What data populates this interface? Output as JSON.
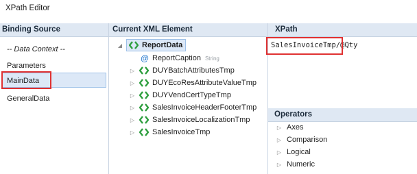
{
  "window": {
    "title": "XPath Editor"
  },
  "binding_source": {
    "header": "Binding Source",
    "items": [
      {
        "label": "-- Data Context --",
        "italic": true
      },
      {
        "label": "Parameters"
      },
      {
        "label": "MainData",
        "selected": true
      },
      {
        "label": "GeneralData"
      }
    ]
  },
  "xml_element": {
    "header": "Current XML Element",
    "root": {
      "label": "ReportData",
      "expanded": true
    },
    "children": [
      {
        "label": "ReportCaption",
        "kind": "attribute",
        "type": "String"
      },
      {
        "label": "DUYBatchAttributesTmp",
        "kind": "element"
      },
      {
        "label": "DUYEcoResAttributeValueTmp",
        "kind": "element"
      },
      {
        "label": "DUYVendCertTypeTmp",
        "kind": "element"
      },
      {
        "label": "SalesInvoiceHeaderFooterTmp",
        "kind": "element"
      },
      {
        "label": "SalesInvoiceLocalizationTmp",
        "kind": "element"
      },
      {
        "label": "SalesInvoiceTmp",
        "kind": "element"
      }
    ]
  },
  "xpath": {
    "header": "XPath",
    "value_part1": "SalesInvoiceTmp",
    "value_part2": "/@Qty"
  },
  "operators": {
    "header": "Operators",
    "items": [
      {
        "label": "Axes"
      },
      {
        "label": "Comparison"
      },
      {
        "label": "Logical"
      },
      {
        "label": "Numeric"
      }
    ]
  },
  "colors": {
    "header_bg": "#dfe8f3",
    "selection_bg": "#dce8f7",
    "highlight_box": "#e03131",
    "xml_icon_green": "#2e9e3e"
  }
}
